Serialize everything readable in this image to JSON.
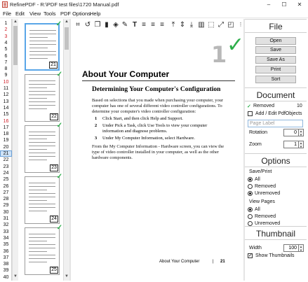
{
  "window": {
    "title": "RefinePDF - R:\\PDF test files\\1720 Manual.pdf",
    "minimize": "–",
    "maximize": "☐",
    "close": "✕"
  },
  "menu": [
    "File",
    "Edit",
    "View",
    "Tools",
    "PDF Options",
    "Help"
  ],
  "page_numbers": [
    {
      "n": "1",
      "red": false
    },
    {
      "n": "2",
      "red": true
    },
    {
      "n": "3",
      "red": true
    },
    {
      "n": "4",
      "red": false
    },
    {
      "n": "5",
      "red": false
    },
    {
      "n": "6",
      "red": false
    },
    {
      "n": "7",
      "red": false
    },
    {
      "n": "8",
      "red": false
    },
    {
      "n": "9",
      "red": false
    },
    {
      "n": "10",
      "red": true
    },
    {
      "n": "11",
      "red": false
    },
    {
      "n": "12",
      "red": false
    },
    {
      "n": "13",
      "red": false
    },
    {
      "n": "14",
      "red": false
    },
    {
      "n": "15",
      "red": false
    },
    {
      "n": "16",
      "red": true
    },
    {
      "n": "17",
      "red": false
    },
    {
      "n": "18",
      "red": false
    },
    {
      "n": "19",
      "red": false
    },
    {
      "n": "20",
      "red": false
    },
    {
      "n": "21",
      "red": false,
      "selected": true
    },
    {
      "n": "22",
      "red": false
    },
    {
      "n": "23",
      "red": false
    },
    {
      "n": "24",
      "red": false
    },
    {
      "n": "25",
      "red": false
    },
    {
      "n": "26",
      "red": false
    },
    {
      "n": "27",
      "red": false
    },
    {
      "n": "28",
      "red": false
    },
    {
      "n": "29",
      "red": false
    },
    {
      "n": "30",
      "red": false
    },
    {
      "n": "31",
      "red": false
    },
    {
      "n": "32",
      "red": false
    },
    {
      "n": "33",
      "red": false
    },
    {
      "n": "34",
      "red": false
    },
    {
      "n": "35",
      "red": false
    },
    {
      "n": "36",
      "red": false
    },
    {
      "n": "37",
      "red": false
    },
    {
      "n": "38",
      "red": false
    },
    {
      "n": "39",
      "red": false
    },
    {
      "n": "40",
      "red": false
    }
  ],
  "thumbnails": [
    {
      "page": "21",
      "selected": true
    },
    {
      "page": "22",
      "selected": false
    },
    {
      "page": "23",
      "selected": false
    },
    {
      "page": "24",
      "selected": false
    },
    {
      "page": "25",
      "selected": false
    }
  ],
  "thumb_check": "✓",
  "toolbar_icons": [
    "crop-icon",
    "rotate-icon",
    "copy-icon",
    "delete-icon",
    "stamp-icon",
    "pen-icon",
    "text-icon",
    "align-left-icon",
    "align-center-icon",
    "align-right-icon",
    "valign-top-icon",
    "valign-middle-icon",
    "valign-bottom-icon",
    "columns-icon",
    "fit-page-icon",
    "expand-icon",
    "more-icon"
  ],
  "page": {
    "big_number": "1",
    "big_check": "✓",
    "heading": "About Your Computer",
    "subheading": "Determining Your Computer's Configuration",
    "intro": "Based on selections that you made when purchasing your computer, your computer has one of several different video controller configurations. To determine your computer's video controller configuration:",
    "steps": [
      {
        "n": "1",
        "text": "Click Start, and then click Help and Support."
      },
      {
        "n": "2",
        "text": "Under Pick a Task, click Use Tools to view your computer information and diagnose problems."
      },
      {
        "n": "3",
        "text": "Under My Computer Information, select Hardware."
      }
    ],
    "outro": "From the My Computer Information - Hardware screen, you can view the type of video controller installed in your computer, as well as the other hardware components.",
    "footer_title": "About Your Computer",
    "footer_sep": "|",
    "footer_page": "21"
  },
  "panel": {
    "file": {
      "header": "File",
      "buttons": [
        "Open",
        "Save",
        "Save As",
        "Print",
        "Sort"
      ]
    },
    "document": {
      "header": "Document",
      "removed_mark": "✓",
      "removed_label": "Removed",
      "removed_count": "10",
      "add_edit_label": "Add / Edit PdfObjects",
      "page_label_placeholder": "Page Label",
      "rotation_label": "Rotation",
      "rotation_value": "0",
      "zoom_label": "Zoom",
      "zoom_value": "1"
    },
    "options": {
      "header": "Options",
      "save_print_label": "Save/Print",
      "save_print": [
        {
          "label": "All",
          "checked": true
        },
        {
          "label": "Removed",
          "checked": false
        },
        {
          "label": "Unremoved",
          "checked": true
        }
      ],
      "view_pages_label": "View Pages",
      "view_pages": [
        {
          "label": "All",
          "checked": true
        },
        {
          "label": "Removed",
          "checked": false
        },
        {
          "label": "Unremoved",
          "checked": false
        }
      ]
    },
    "thumbnail": {
      "header": "Thumbnail",
      "width_label": "Width",
      "width_value": "100",
      "show_label": "Show Thumbnails",
      "show_checked": true,
      "check": "✓"
    }
  }
}
